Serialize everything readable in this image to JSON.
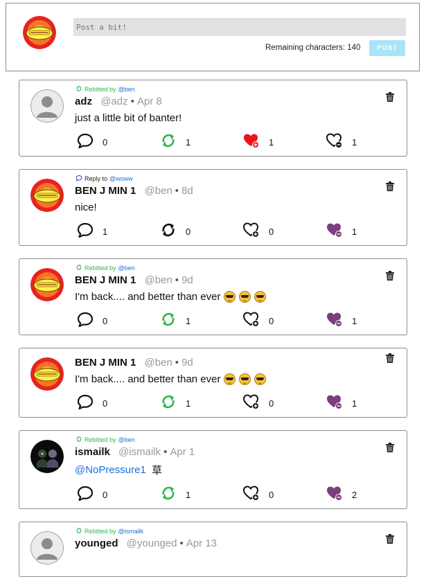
{
  "composer": {
    "placeholder": "Post a bit!",
    "remaining_label": "Remaining characters: 140",
    "post_label": "POST"
  },
  "colors": {
    "rebit_green": "#2db84a",
    "link_blue": "#1c6fd8",
    "like_red": "#e8141b",
    "dislike_purple": "#7a3f7c",
    "post_button": "#a8e3f8"
  },
  "posts": [
    {
      "context_kind": "Rebitted by",
      "context_user": "@ben",
      "name": "adz",
      "handle": "@adz",
      "date": "Apr 8",
      "text": "just a little bit of banter!",
      "avatar": "default-avatar",
      "reply_count": "0",
      "rebit_count": "1",
      "like_count": "1",
      "dislike_count": "1",
      "rebit_active": true,
      "like_active": true,
      "dislike_active": false
    },
    {
      "context_kind": "Reply to",
      "context_user": "@woww",
      "name": "BEN J MIN 1",
      "handle": "@ben",
      "date": "8d",
      "text": "nice!",
      "avatar": "badge-avatar",
      "reply_count": "1",
      "rebit_count": "0",
      "like_count": "0",
      "dislike_count": "1",
      "rebit_active": false,
      "like_active": false,
      "dislike_active": true
    },
    {
      "context_kind": "Rebitted by",
      "context_user": "@ben",
      "name": "BEN J MIN 1",
      "handle": "@ben",
      "date": "9d",
      "text": "I'm back.... and better than ever",
      "avatar": "badge-avatar",
      "reply_count": "0",
      "rebit_count": "1",
      "like_count": "0",
      "dislike_count": "1",
      "rebit_active": true,
      "like_active": false,
      "dislike_active": true
    },
    {
      "context_kind": "",
      "context_user": "",
      "name": "BEN J MIN 1",
      "handle": "@ben",
      "date": "9d",
      "text": "I'm back.... and better than ever",
      "avatar": "badge-avatar",
      "reply_count": "0",
      "rebit_count": "1",
      "like_count": "0",
      "dislike_count": "1",
      "rebit_active": true,
      "like_active": false,
      "dislike_active": true
    },
    {
      "context_kind": "Rebitted by",
      "context_user": "@ben",
      "name": "ismailk",
      "handle": "@ismailk",
      "date": "Apr 1",
      "text_mention": "@NoPressure1",
      "text": "草",
      "avatar": "dark-photo-avatar",
      "reply_count": "0",
      "rebit_count": "1",
      "like_count": "0",
      "dislike_count": "2",
      "rebit_active": true,
      "like_active": false,
      "dislike_active": true
    },
    {
      "context_kind": "Rebitted by",
      "context_user": "@ismailk",
      "name": "younged",
      "handle": "@younged",
      "date": "Apr 13",
      "avatar": "default-avatar"
    }
  ]
}
